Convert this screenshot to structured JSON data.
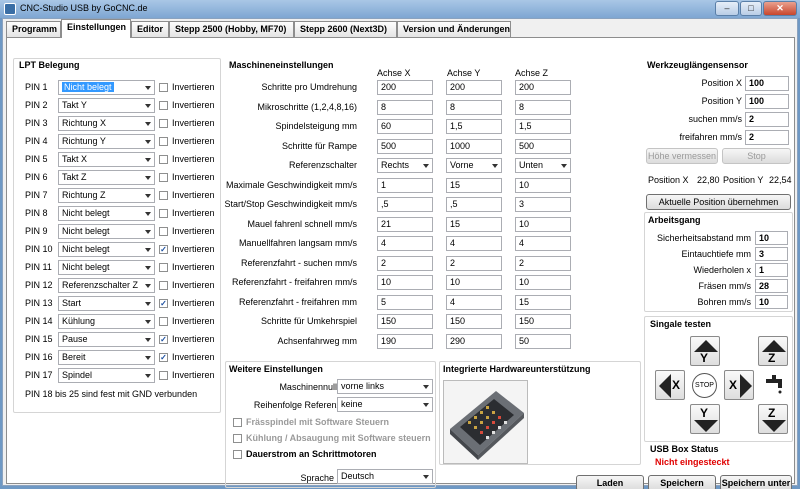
{
  "window": {
    "title": "CNC-Studio USB by GoCNC.de",
    "min": "–",
    "max": "□",
    "close": "✕"
  },
  "tabs": [
    "Programm",
    "Einstellungen",
    "Editor",
    "Stepp 2500 (Hobby, MF70)",
    "Stepp 2600 (Next3D)",
    "Version und Änderungen"
  ],
  "lpt": {
    "title": "LPT Belegung",
    "inv_label": "Invertieren",
    "footer": "PIN 18 bis 25 sind fest mit GND verbunden",
    "pins": [
      {
        "label": "PIN 1",
        "value": "Nicht belegt",
        "inv": false
      },
      {
        "label": "PIN 2",
        "value": "Takt Y",
        "inv": false
      },
      {
        "label": "PIN 3",
        "value": "Richtung X",
        "inv": false
      },
      {
        "label": "PIN 4",
        "value": "Richtung Y",
        "inv": false
      },
      {
        "label": "PIN 5",
        "value": "Takt X",
        "inv": false
      },
      {
        "label": "PIN 6",
        "value": "Takt Z",
        "inv": false
      },
      {
        "label": "PIN 7",
        "value": "Richtung Z",
        "inv": false
      },
      {
        "label": "PIN 8",
        "value": "Nicht belegt",
        "inv": false
      },
      {
        "label": "PIN 9",
        "value": "Nicht belegt",
        "inv": false
      },
      {
        "label": "PIN 10",
        "value": "Nicht belegt",
        "inv": true
      },
      {
        "label": "PIN 11",
        "value": "Nicht belegt",
        "inv": false
      },
      {
        "label": "PIN 12",
        "value": "Referenzschalter Z",
        "inv": false
      },
      {
        "label": "PIN 13",
        "value": "Start",
        "inv": true
      },
      {
        "label": "PIN 14",
        "value": "Kühlung",
        "inv": false
      },
      {
        "label": "PIN 15",
        "value": "Pause",
        "inv": true
      },
      {
        "label": "PIN 16",
        "value": "Bereit",
        "inv": true
      },
      {
        "label": "PIN 17",
        "value": "Spindel",
        "inv": false
      }
    ]
  },
  "machine": {
    "title": "Maschineneinstellungen",
    "axes": [
      "Achse X",
      "Achse Y",
      "Achse Z"
    ],
    "rows": [
      {
        "label": "Schritte pro Umdrehung",
        "values": [
          "200",
          "200",
          "200"
        ]
      },
      {
        "label": "Mikroschritte (1,2,4,8,16)",
        "values": [
          "8",
          "8",
          "8"
        ]
      },
      {
        "label": "Spindelsteigung mm",
        "values": [
          "60",
          "1,5",
          "1,5"
        ]
      },
      {
        "label": "Schritte für Rampe",
        "values": [
          "500",
          "1000",
          "500"
        ]
      },
      {
        "label": "Referenzschalter",
        "values": [
          "Rechts",
          "Vorne",
          "Unten"
        ],
        "select": true
      },
      {
        "label": "Maximale Geschwindigkeit mm/s",
        "values": [
          "1",
          "15",
          "10"
        ]
      },
      {
        "label": "Start/Stop Geschwindigkeit mm/s",
        "values": [
          ",5",
          ",5",
          "3"
        ]
      },
      {
        "label": "Mauel fahrenl schnell mm/s",
        "values": [
          "21",
          "15",
          "10"
        ]
      },
      {
        "label": "Manuellfahren langsam mm/s",
        "values": [
          "4",
          "4",
          "4"
        ]
      },
      {
        "label": "Referenzfahrt - suchen mm/s",
        "values": [
          "2",
          "2",
          "2"
        ]
      },
      {
        "label": "Referenzfahrt - freifahren mm/s",
        "values": [
          "10",
          "10",
          "10"
        ]
      },
      {
        "label": "Referenzfahrt - freifahren mm",
        "values": [
          "5",
          "4",
          "15"
        ]
      },
      {
        "label": "Schritte für Umkehrspiel",
        "values": [
          "150",
          "150",
          "150"
        ]
      },
      {
        "label": "Achsenfahrweg mm",
        "values": [
          "190",
          "290",
          "50"
        ]
      }
    ]
  },
  "tool_sensor": {
    "title": "Werkzeuglängensensor",
    "fields": [
      {
        "label": "Position X",
        "value": "100"
      },
      {
        "label": "Position Y",
        "value": "100"
      },
      {
        "label": "suchen mm/s",
        "value": "2"
      },
      {
        "label": "freifahren mm/s",
        "value": "2"
      }
    ],
    "btn_measure": "Höhe vermessen",
    "btn_stop": "Stop",
    "pos_x_label": "Position X",
    "pos_x_value": "22,80",
    "pos_y_label": "Position Y",
    "pos_y_value": "22,54",
    "btn_take": "Aktuelle Position übernehmen"
  },
  "work": {
    "title": "Arbeitsgang",
    "fields": [
      {
        "label": "Sicherheitsabstand mm",
        "value": "10"
      },
      {
        "label": "Eintauchtiefe mm",
        "value": "3"
      },
      {
        "label": "Wiederholen x",
        "value": "1"
      },
      {
        "label": "Fräsen mm/s",
        "value": "28"
      },
      {
        "label": "Bohren mm/s",
        "value": "10"
      }
    ]
  },
  "signals": {
    "title": "Singale testen",
    "y": "Y",
    "x": "X",
    "z": "Z",
    "stop": "STOP"
  },
  "usb": {
    "title": "USB Box Status",
    "status": "Nicht eingesteckt",
    "status_color": "#e00000"
  },
  "more": {
    "title": "Weitere Einstellungen",
    "null_label": "Maschinennullpunkt",
    "null_value": "vorne links",
    "order_label": "Reihenfolge Referenzfahrt",
    "order_value": "keine",
    "cb_spindle": "Frässpindel mit Software Steuern",
    "cb_cool": "Kühlung / Absaugung mit Software steuern",
    "cb_current": "Dauerstrom an Schrittmotoren",
    "lang_label": "Sprache",
    "lang_value": "Deutsch"
  },
  "hw": {
    "title": "Integrierte Hardwareunterstützung"
  },
  "buttons": {
    "load": "Laden",
    "save": "Speichern",
    "save_as": "Speichern unter"
  }
}
